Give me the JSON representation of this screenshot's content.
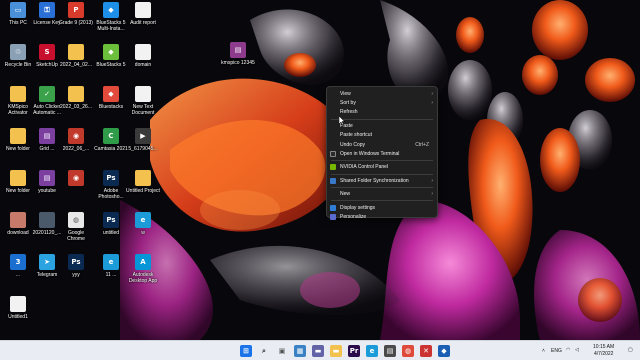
{
  "desktop": {
    "icons": [
      {
        "label": "This PC",
        "icon": "monitor-icon",
        "color": "#4a90d9",
        "glyph": "▭"
      },
      {
        "label": "License Key",
        "icon": "key-doc-icon",
        "color": "#2a6fd6",
        "glyph": "⚿"
      },
      {
        "label": "Grade 9 (2013)",
        "icon": "pdf-icon",
        "color": "#d83b2b",
        "glyph": "P"
      },
      {
        "label": "BlueStacks 5 Multi-Insta...",
        "icon": "bluestacks-icon",
        "color": "#1d8fe8",
        "glyph": "◆"
      },
      {
        "label": "Audit report",
        "icon": "document-icon",
        "color": "#f2f2f2",
        "glyph": ""
      },
      {
        "label": "Recycle Bin",
        "icon": "recycle-bin-icon",
        "color": "#8aa0b4",
        "glyph": "♲"
      },
      {
        "label": "SketchUp",
        "icon": "sketchup-icon",
        "color": "#c8102e",
        "glyph": "S"
      },
      {
        "label": "2022_04_02...",
        "icon": "folder-icon",
        "color": "#f2c14e",
        "glyph": ""
      },
      {
        "label": "BlueStacks 5",
        "icon": "bluestacks-icon",
        "color": "#6bbf3a",
        "glyph": "◆"
      },
      {
        "label": "domain",
        "icon": "document-icon",
        "color": "#f2f2f2",
        "glyph": ""
      },
      {
        "label": "KMSpico Activator",
        "icon": "folder-icon",
        "color": "#f2c14e",
        "glyph": ""
      },
      {
        "label": "Auto Clicker Automatic ...",
        "icon": "auto-clicker-icon",
        "color": "#3aa24a",
        "glyph": "✓"
      },
      {
        "label": "2022_03_26...",
        "icon": "folder-icon",
        "color": "#f2c14e",
        "glyph": ""
      },
      {
        "label": "Bluestacks",
        "icon": "bluestacks-icon",
        "color": "#e24b3b",
        "glyph": "◆"
      },
      {
        "label": "New Text Document",
        "icon": "document-icon",
        "color": "#f2f2f2",
        "glyph": ""
      },
      {
        "label": "New folder",
        "icon": "folder-icon",
        "color": "#f2c14e",
        "glyph": ""
      },
      {
        "label": "Grid ...",
        "icon": "archive-icon",
        "color": "#7b3fa0",
        "glyph": "▤"
      },
      {
        "label": "2022_06_...",
        "icon": "app-icon",
        "color": "#c0392b",
        "glyph": "◉"
      },
      {
        "label": "Camtasia 2021",
        "icon": "camtasia-icon",
        "color": "#2e9c48",
        "glyph": "C"
      },
      {
        "label": "5_6179045...",
        "icon": "video-icon",
        "color": "#3a3a3a",
        "glyph": "▶"
      },
      {
        "label": "New folder",
        "icon": "folder-icon",
        "color": "#f2c14e",
        "glyph": ""
      },
      {
        "label": "youtube",
        "icon": "archive-icon",
        "color": "#7b3fa0",
        "glyph": "▤"
      },
      {
        "label": "",
        "icon": "app-icon",
        "color": "#c0392b",
        "glyph": "◉"
      },
      {
        "label": "Adobe Photosho...",
        "icon": "photoshop-icon",
        "color": "#0a2a52",
        "glyph": "Ps"
      },
      {
        "label": "Untitled Project",
        "icon": "folder-icon",
        "color": "#f2c14e",
        "glyph": ""
      },
      {
        "label": "download",
        "icon": "photo-icon",
        "color": "#c87a6a",
        "glyph": ""
      },
      {
        "label": "20201120_...",
        "icon": "photo-icon",
        "color": "#4a5a6a",
        "glyph": ""
      },
      {
        "label": "Google Chrome",
        "icon": "chrome-icon",
        "color": "#e8e8e8",
        "glyph": "◍"
      },
      {
        "label": "untitled",
        "icon": "photoshop-file-icon",
        "color": "#0a2a52",
        "glyph": "Ps"
      },
      {
        "label": "w",
        "icon": "edge-icon",
        "color": "#1b9bd7",
        "glyph": "e"
      },
      {
        "label": "...",
        "icon": "app-icon",
        "color": "#1a6fd0",
        "glyph": "3"
      },
      {
        "label": "Telegram",
        "icon": "telegram-icon",
        "color": "#2aa3e0",
        "glyph": "➤"
      },
      {
        "label": "yyy",
        "icon": "photoshop-file-icon",
        "color": "#0a2a52",
        "glyph": "Ps"
      },
      {
        "label": "11 ...",
        "icon": "edge-icon",
        "color": "#1b9bd7",
        "glyph": "e"
      },
      {
        "label": "Autodesk Desktop App",
        "icon": "autodesk-icon",
        "color": "#0696d7",
        "glyph": "A"
      },
      {
        "label": "Untitled1",
        "icon": "document-icon",
        "color": "#f2f2f2",
        "glyph": ""
      },
      {
        "label": "kmspico 12345",
        "icon": "winrar-icon",
        "color": "#8e3b8e",
        "glyph": "▤"
      }
    ]
  },
  "context_menu": {
    "view": "View",
    "sort_by": "Sort by",
    "refresh": "Refresh",
    "paste": "Paste",
    "paste_shortcut": "Paste shortcut",
    "undo_copy": "Undo Copy",
    "undo_copy_shortcut": "Ctrl+Z",
    "open_terminal": "Open in Windows Terminal",
    "nvidia": "NVIDIA Control Panel",
    "shared_folder": "Shared Folder Synchronization",
    "new": "New",
    "display_settings": "Display settings",
    "personalize": "Personalize"
  },
  "taskbar": {
    "apps": [
      {
        "icon": "windows-start-icon",
        "color": "#1a73e8",
        "glyph": "⊞"
      },
      {
        "icon": "search-icon",
        "color": "#333333",
        "glyph": "⌕"
      },
      {
        "icon": "task-view-icon",
        "color": "#555555",
        "glyph": "▣"
      },
      {
        "icon": "widgets-icon",
        "color": "#3b82c4",
        "glyph": "▦"
      },
      {
        "icon": "teams-chat-icon",
        "color": "#6264a7",
        "glyph": "▬"
      },
      {
        "icon": "file-explorer-icon",
        "color": "#f2c14e",
        "glyph": "▬"
      },
      {
        "icon": "premiere-icon",
        "color": "#2a0a4a",
        "glyph": "Pr"
      },
      {
        "icon": "edge-icon",
        "color": "#1b9bd7",
        "glyph": "e"
      },
      {
        "icon": "store-icon",
        "color": "#4a4a4a",
        "glyph": "▤"
      },
      {
        "icon": "chrome-icon",
        "color": "#e04a3a",
        "glyph": "◍"
      },
      {
        "icon": "app-icon",
        "color": "#cc3333",
        "glyph": "✕"
      },
      {
        "icon": "security-icon",
        "color": "#1a5fb4",
        "glyph": "◆"
      }
    ],
    "tray": {
      "language": "ENG",
      "time": "10:15 AM",
      "date": "4/7/2022"
    }
  },
  "colors": {
    "taskbar_bg": "#e9edf3",
    "menu_bg": "#202020",
    "wallpaper_bg": "#08080c"
  }
}
